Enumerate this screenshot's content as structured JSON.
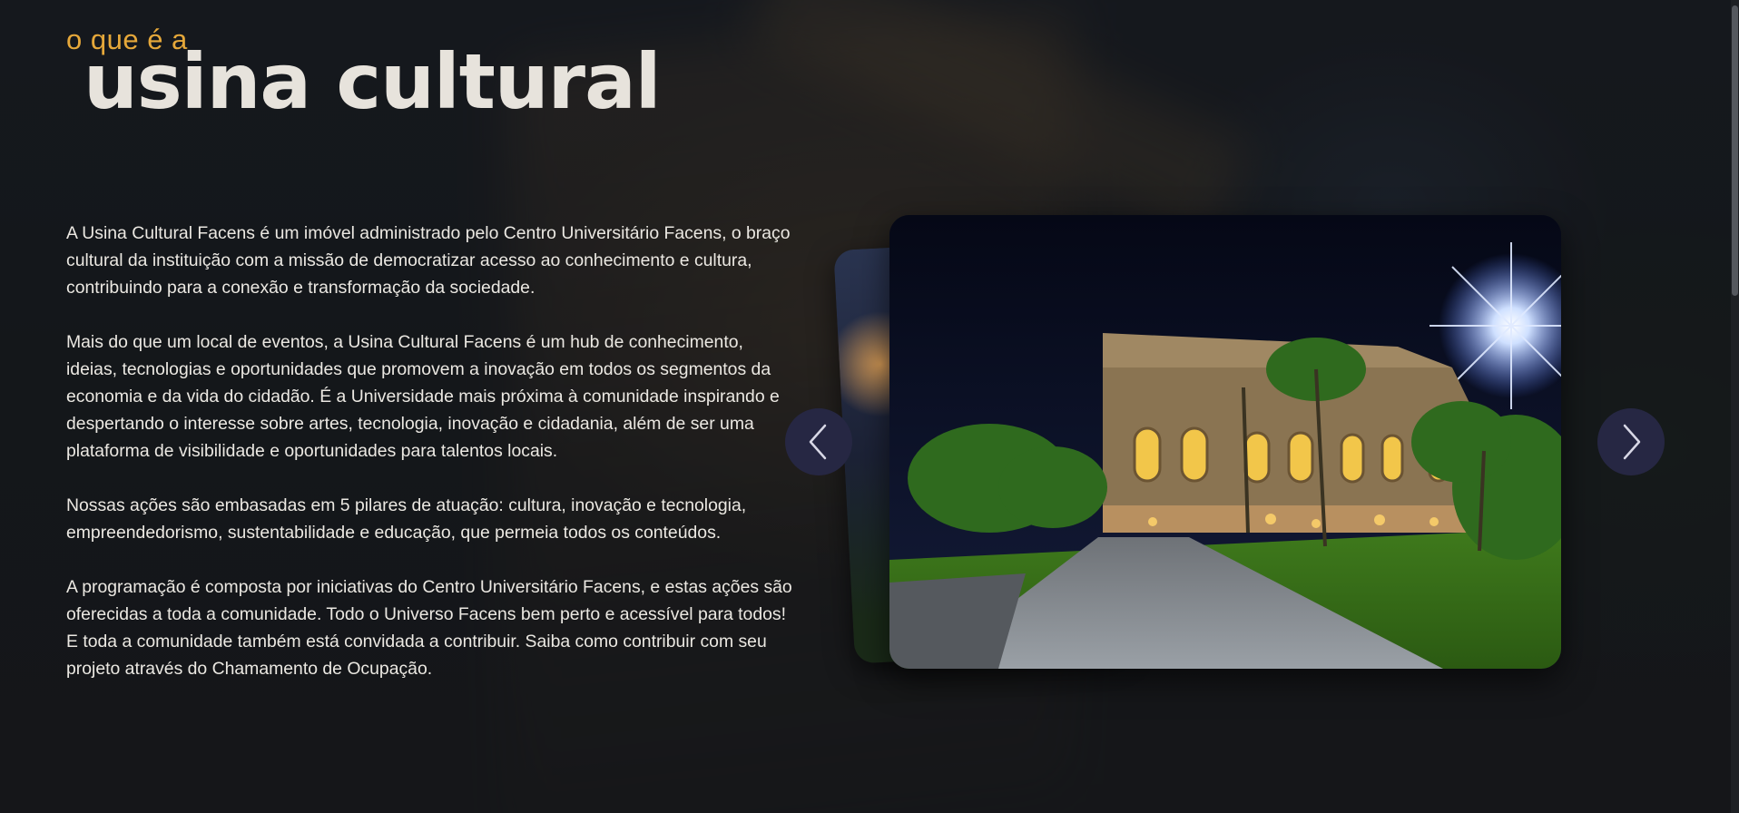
{
  "header": {
    "kicker": "o que é a",
    "title": "usina cultural"
  },
  "paragraphs": [
    "A Usina Cultural Facens é um imóvel administrado pelo Centro Universitário Facens, o braço cultural da instituição com a missão de democratizar acesso ao conhecimento e cultura, contribuindo para a conexão e transformação da sociedade.",
    "Mais do que um local de eventos, a Usina Cultural Facens é um hub de conhecimento, ideias, tecnologias e oportunidades que promovem a inovação em todos os segmentos da economia e da vida do cidadão. É a Universidade mais próxima à comunidade inspirando e despertando o interesse sobre artes, tecnologia, inovação e cidadania, além de ser uma plataforma de visibilidade e oportunidades para talentos locais.",
    "Nossas ações são embasadas em 5 pilares de atuação: cultura, inovação e tecnologia, empreendedorismo, sustentabilidade e educação, que permeia todos os conteúdos.",
    "A programação é composta por iniciativas do Centro Universitário Facens, e estas ações são oferecidas a toda a comunidade. Todo o Universo Facens bem perto e acessível para todos! E toda a comunidade também está convidada a contribuir. Saiba como contribuir com seu projeto através do Chamamento de Ocupação."
  ],
  "carousel": {
    "prev_icon": "chevron-left-icon",
    "next_icon": "chevron-right-icon"
  },
  "colors": {
    "accent": "#e6a83a",
    "title": "#e7e3dc",
    "arrow_bg": "#262743"
  }
}
